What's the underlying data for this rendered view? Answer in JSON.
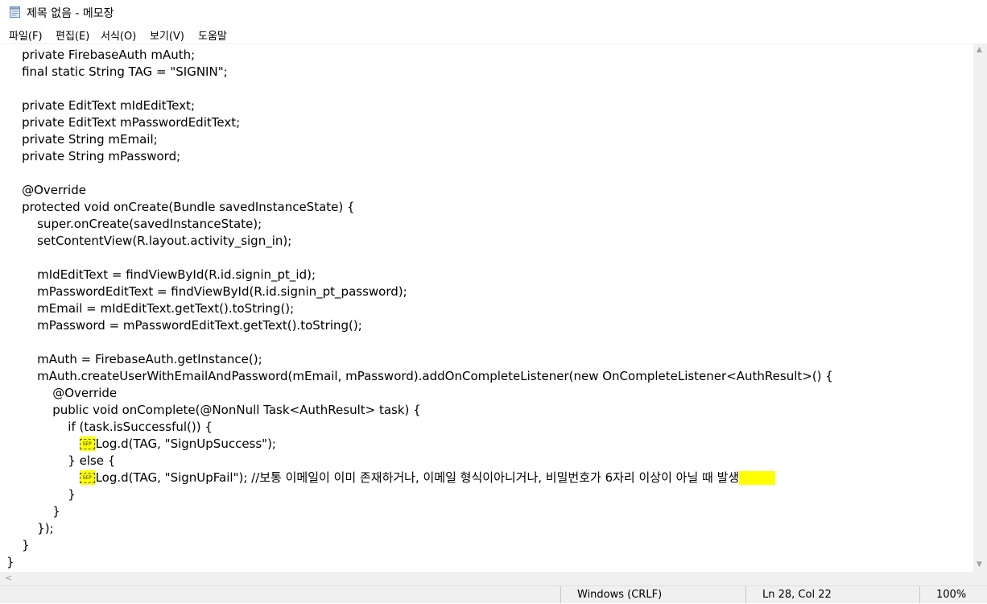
{
  "window": {
    "title": "제목 없음 - 메모장",
    "app_icon": "notepad-icon"
  },
  "menu": [
    "파일(F)",
    "편집(E)",
    "서식(O)",
    "보기(V)",
    "도움말"
  ],
  "editor": {
    "lines": [
      "    private FirebaseAuth mAuth;",
      "    final static String TAG = \"SIGNIN\";",
      "",
      "    private EditText mIdEditText;",
      "    private EditText mPasswordEditText;",
      "    private String mEmail;",
      "    private String mPassword;",
      "",
      "    @Override",
      "    protected void onCreate(Bundle savedInstanceState) {",
      "        super.onCreate(savedInstanceState);",
      "        setContentView(R.layout.activity_sign_in);",
      "",
      "        mIdEditText = findViewById(R.id.signin_pt_id);",
      "        mPasswordEditText = findViewById(R.id.signin_pt_password);",
      "        mEmail = mIdEditText.getText().toString();",
      "        mPassword = mPasswordEditText.getText().toString();",
      "",
      "        mAuth = FirebaseAuth.getInstance();",
      "        mAuth.createUserWithEmailAndPassword(mEmail, mPassword).addOnCompleteListener(new OnCompleteListener<AuthResult>() {",
      "            @Override",
      "            public void onComplete(@NonNull Task<AuthResult> task) {",
      "                if (task.isSuccessful()) {",
      "                    Log.d(TAG, \"SignUpSuccess\");",
      "                } else {",
      "                    Log.d(TAG, \"SignUpFail\"); //보통 이메일이 이미 존재하거나, 이메일 형식이아니거나, 비밀번호가 6자리 이상이 아닐 때 발생",
      "                }",
      "            }",
      "        });",
      "    }",
      "}"
    ],
    "highlight_color": "#ffff00",
    "sep_glyph_label": "SEP"
  },
  "status": {
    "line_ending": "Windows (CRLF)",
    "position": "Ln 28, Col 22",
    "zoom": "100%"
  }
}
